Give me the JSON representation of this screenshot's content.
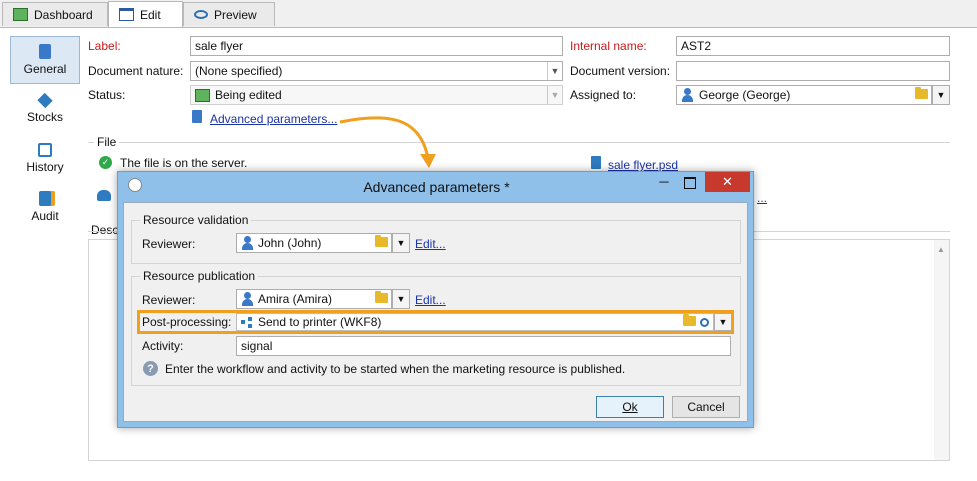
{
  "tabs": [
    {
      "label": "Dashboard"
    },
    {
      "label": "Edit"
    },
    {
      "label": "Preview"
    }
  ],
  "nav": [
    {
      "label": "General"
    },
    {
      "label": "Stocks"
    },
    {
      "label": "History"
    },
    {
      "label": "Audit"
    }
  ],
  "form": {
    "label_label": "Label:",
    "label_value": "sale flyer",
    "internal_label": "Internal name:",
    "internal_value": "AST2",
    "nature_label": "Document nature:",
    "nature_value": "(None specified)",
    "version_label": "Document version:",
    "version_value": "",
    "status_label": "Status:",
    "status_value": "Being edited",
    "assigned_label": "Assigned to:",
    "assigned_value": "George (George)",
    "advanced_link": "Advanced parameters..."
  },
  "file": {
    "group_title": "File",
    "status_text": "The file is on the server.",
    "file_link": "sale flyer.psd",
    "partial_link": "..."
  },
  "description": {
    "group_title": "Descr"
  },
  "dialog": {
    "title": "Advanced parameters *",
    "validation": {
      "group_title": "Resource validation",
      "reviewer_label": "Reviewer:",
      "reviewer_value": "John (John)",
      "edit_link": "Edit..."
    },
    "publication": {
      "group_title": "Resource publication",
      "reviewer_label": "Reviewer:",
      "reviewer_value": "Amira (Amira)",
      "edit_link": "Edit...",
      "post_label": "Post-processing:",
      "post_value": "Send to printer (WKF8)",
      "activity_label": "Activity:",
      "activity_value": "signal",
      "help_text": "Enter the workflow and activity to be started when the marketing resource is published."
    },
    "ok_label": "Ok",
    "cancel_label": "Cancel"
  },
  "colors": {
    "highlight": "#f0a01e",
    "arrow": "#f0a01e",
    "title_bar": "#8ec0ea",
    "required_label": "#c81a1a"
  }
}
